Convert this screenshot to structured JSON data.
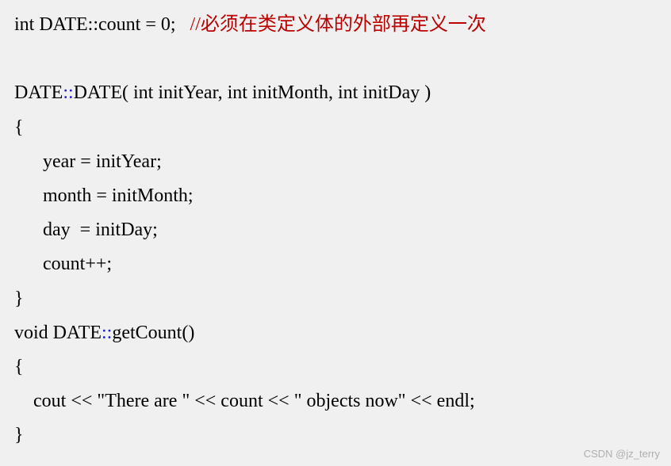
{
  "code": {
    "line1": {
      "pre": "int DATE::count = 0;   ",
      "comment": "//必须在类定义体的外部再定义一次"
    },
    "line2": {
      "pre": "DATE",
      "scope": "::",
      "post": "DATE( int initYear, int initMonth, int initDay )"
    },
    "line3": "{",
    "line4": "year = initYear;",
    "line5": "month = initMonth;",
    "line6": "day  = initDay;",
    "line7": "count++;",
    "line8": "}",
    "line9": {
      "pre": "void DATE",
      "scope": "::",
      "post": "getCount()"
    },
    "line10": "{",
    "line11": "cout << \"There are \" << count << \" objects now\" << endl;",
    "line12": "}"
  },
  "watermark": "CSDN @jz_terry"
}
